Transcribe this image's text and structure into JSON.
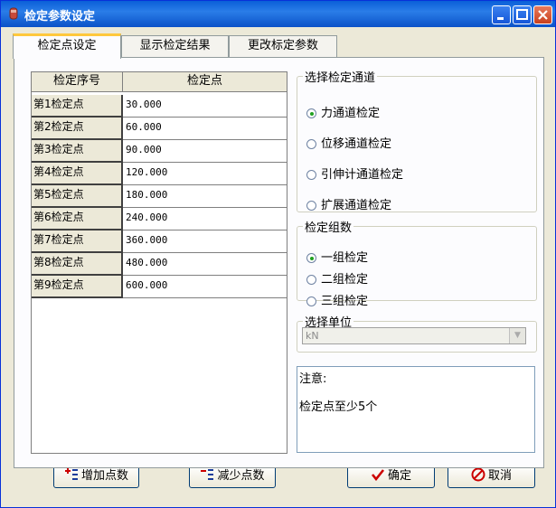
{
  "window": {
    "title": "检定参数设定"
  },
  "tabs": [
    {
      "label": "检定点设定",
      "active": true
    },
    {
      "label": "显示检定结果",
      "active": false
    },
    {
      "label": "更改标定参数",
      "active": false
    }
  ],
  "table": {
    "headers": [
      "检定序号",
      "检定点"
    ],
    "rows": [
      {
        "label": "第1检定点",
        "value": "30.000"
      },
      {
        "label": "第2检定点",
        "value": "60.000"
      },
      {
        "label": "第3检定点",
        "value": "90.000"
      },
      {
        "label": "第4检定点",
        "value": "120.000"
      },
      {
        "label": "第5检定点",
        "value": "180.000"
      },
      {
        "label": "第6检定点",
        "value": "240.000"
      },
      {
        "label": "第7检定点",
        "value": "360.000"
      },
      {
        "label": "第8检定点",
        "value": "480.000"
      },
      {
        "label": "第9检定点",
        "value": "600.000"
      }
    ]
  },
  "channel_group": {
    "title": "选择检定通道",
    "options": [
      "力通道检定",
      "位移通道检定",
      "引伸计通道检定",
      "扩展通道检定"
    ],
    "selected_index": 0
  },
  "group_count": {
    "title": "检定组数",
    "options": [
      "一组检定",
      "二组检定",
      "三组检定"
    ],
    "selected_index": 0
  },
  "unit": {
    "title": "选择单位",
    "value": "kN"
  },
  "note": {
    "title": "注意:",
    "text": "检定点至少5个"
  },
  "buttons": {
    "add": "增加点数",
    "remove": "减少点数",
    "ok": "确定",
    "cancel": "取消"
  },
  "colors": {
    "title_bar": "#0a5fd8",
    "tab_highlight": "#ffc83c",
    "radio_dot": "#21a121"
  }
}
